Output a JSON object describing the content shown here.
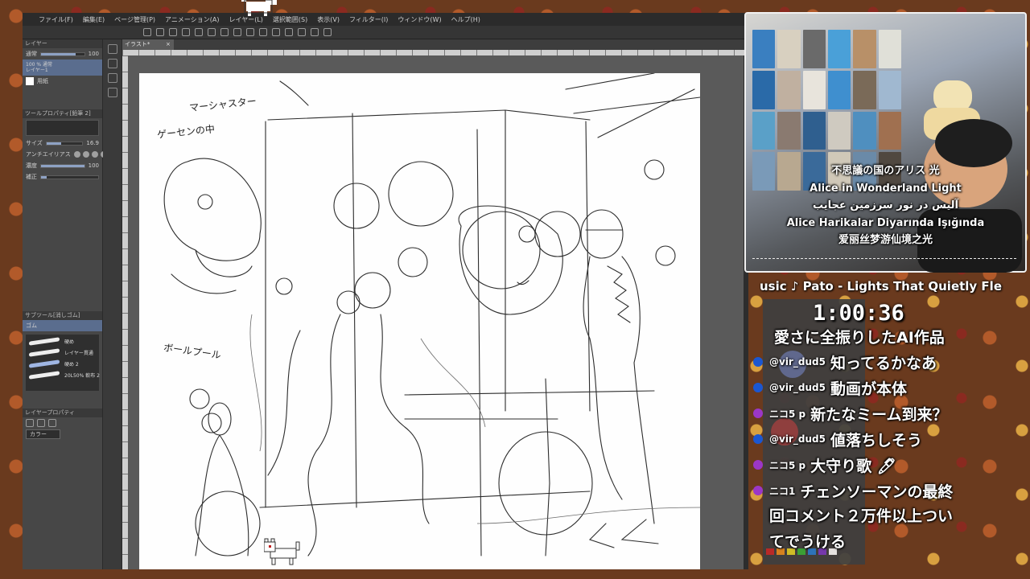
{
  "app": {
    "menu": [
      "ファイル(F)",
      "編集(E)",
      "ページ管理(P)",
      "アニメーション(A)",
      "レイヤー(L)",
      "選択範囲(S)",
      "表示(V)",
      "フィルター(I)",
      "ウィンドウ(W)",
      "ヘルプ(H)"
    ],
    "document_tab": "イラスト*",
    "panels": {
      "layer_title": "レイヤー",
      "blend_mode": "通常",
      "opacity": "100",
      "layers": [
        {
          "name": "100 % 通常\nレイヤー1",
          "selected": true
        },
        {
          "name": "用紙",
          "selected": false
        }
      ],
      "tool_property_title": "ツールプロパティ[鉛筆 2]",
      "brush_size_label": "サイズ",
      "brush_size_value": "16.9",
      "antialias_label": "アンチエイリアス",
      "density_label": "濃度",
      "density_value": "100",
      "stabilizer_label": "補正",
      "subtool_title": "サブツール[消しゴム]",
      "subtool_group": "ゴム",
      "subtools": [
        "硬め",
        "レイヤー貫通",
        "硬め 2",
        "20L50% 軟布 2"
      ],
      "layer_property_title": "レイヤープロパティ",
      "color_label": "カラー"
    }
  },
  "canvas": {
    "notes": [
      "マーシャスター",
      "ゲーセンの中",
      "ボールプール"
    ]
  },
  "webcam": {
    "caption": [
      "不思議の国のアリス 光",
      "Alice in Wonderland Light",
      "آلیس در نور سرزمین عجایب",
      "Alice Harikalar Diyarında Işığında",
      "爱丽丝梦游仙境之光"
    ]
  },
  "music": {
    "now_playing": "usic ♪ Pato - Lights That Quietly Fle"
  },
  "timer": "1:00:36",
  "chat": {
    "messages": [
      {
        "user": "",
        "text": "愛さに全振りしたAI作品",
        "bullet": "none"
      },
      {
        "user": "@vir_dud5",
        "text": "知ってるかなあ",
        "bullet": "blue"
      },
      {
        "user": "@vir_dud5",
        "text": "動画が本体",
        "bullet": "blue"
      },
      {
        "user": "ニコ5 p",
        "text": "新たなミーム到来？",
        "bullet": "purple"
      },
      {
        "user": "@vir_dud5",
        "text": "値落ちしそう",
        "bullet": "blue"
      },
      {
        "user": "ニコ5 p",
        "text": "大守り歌 🖊",
        "bullet": "purple"
      },
      {
        "user": "ニコ1",
        "text": "チェンソーマンの最終",
        "bullet": "purple"
      }
    ],
    "continuation": [
      "回コメント２万件以上つい",
      "てでうける"
    ]
  },
  "colors": {
    "accent_blue": "#1b57d1",
    "accent_purple": "#9b37c7",
    "app_bg": "#3d3d3d",
    "selected_layer": "#5a6d8e"
  }
}
